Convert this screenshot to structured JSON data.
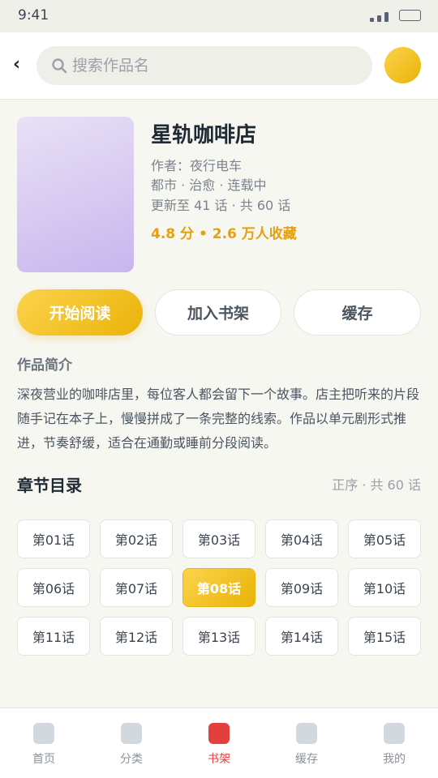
{
  "status_bar": {
    "time": "9:41"
  },
  "header": {
    "back_icon": "‹",
    "search_placeholder": "搜索作品名",
    "search_value": ""
  },
  "book": {
    "title": "星轨咖啡店",
    "author_line": "作者：夜行电车",
    "tags_line": "都市 · 治愈 · 连载中",
    "update_line": "更新至 41 话 · 共 60 话",
    "rating_line": "4.8 分 • 2.6 万人收藏"
  },
  "actions": {
    "start_label": "开始阅读",
    "shelf_label": "加入书架",
    "cache_label": "缓存"
  },
  "intro": {
    "label": "作品简介",
    "text": "深夜营业的咖啡店里，每位客人都会留下一个故事。店主把听来的片段随手记在本子上，慢慢拼成了一条完整的线索。作品以单元剧形式推进，节奏舒缓，适合在通勤或睡前分段阅读。"
  },
  "toc": {
    "title": "章节目录",
    "meta": "正序 · 共 60 话",
    "chapters": [
      "第01话",
      "第02话",
      "第03话",
      "第04话",
      "第05话",
      "第06话",
      "第07话",
      "第08话",
      "第09话",
      "第10话",
      "第11话",
      "第12话",
      "第13话",
      "第14话",
      "第15话"
    ],
    "active_chapter": "第08话"
  },
  "tabbar": {
    "tabs": [
      {
        "label": "首页"
      },
      {
        "label": "分类"
      },
      {
        "label": "书架"
      },
      {
        "label": "缓存"
      },
      {
        "label": "我的"
      }
    ],
    "active_tab": "书架"
  },
  "colors": {
    "accent": "#eab308",
    "rating": "#e4a010",
    "tab_active": "#e53e3e"
  }
}
